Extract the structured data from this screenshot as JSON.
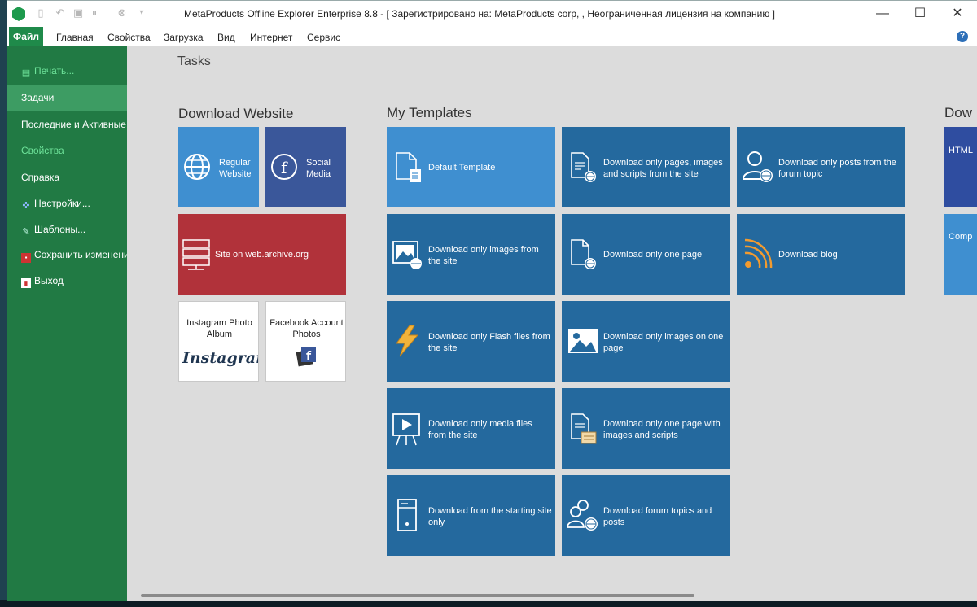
{
  "window": {
    "title": "MetaProducts Offline Explorer Enterprise 8.8 - [ Зарегистрировано на: MetaProducts corp, , Неограниченная лицензия на компанию ]",
    "minimize": "—",
    "maximize": "☐",
    "close": "✕"
  },
  "ribbon": {
    "file": "Файл",
    "tabs": [
      "Главная",
      "Свойства",
      "Загрузка",
      "Вид",
      "Интернет",
      "Сервис"
    ],
    "help": "?"
  },
  "sidebar": {
    "items": [
      {
        "label": "Печать...",
        "icon": "print-icon",
        "state": "disabled"
      },
      {
        "label": "Задачи",
        "state": "active"
      },
      {
        "label": "Последние и Активные",
        "state": "normal"
      },
      {
        "label": "Свойства",
        "state": "disabled"
      },
      {
        "label": "Справка",
        "state": "normal"
      },
      {
        "label": "Настройки...",
        "icon": "settings-icon",
        "state": "normal"
      },
      {
        "label": "Шаблоны...",
        "icon": "templates-icon",
        "state": "normal"
      },
      {
        "label": "Сохранить изменения",
        "icon": "save-icon",
        "state": "normal"
      },
      {
        "label": "Выход",
        "icon": "exit-icon",
        "state": "normal"
      }
    ]
  },
  "main": {
    "title": "Tasks",
    "download_website": {
      "title": "Download Website",
      "tiles": {
        "regular": "Regular Website",
        "social": "Social Media",
        "archive": "Site on web.archive.org",
        "instagram": "Instagram Photo Album",
        "instagram_logo": "Instagram",
        "facebook": "Facebook Account Photos"
      }
    },
    "my_templates": {
      "title": "My Templates",
      "tiles": [
        "Default Template",
        "Download only pages, images and scripts from the site",
        "Download only posts from the forum topic",
        "Download only images from the site",
        "Download only one page",
        "Download blog",
        "Download only Flash files from the site",
        "Download only images on one page",
        "Download only media files from the site",
        "Download only one page with images and scripts",
        "Download from the starting site only",
        "Download forum topics and posts"
      ]
    },
    "partial": {
      "title": "Dow",
      "tile1": "HTML",
      "tile2": "Comp"
    }
  },
  "colors": {
    "sidebar": "#217a44",
    "sidebar_active": "#3d9c63",
    "tile_blue": "#24699e",
    "tile_blue_light": "#3f8fd0",
    "tile_red": "#b1323a",
    "tile_navy": "#3a579a"
  }
}
